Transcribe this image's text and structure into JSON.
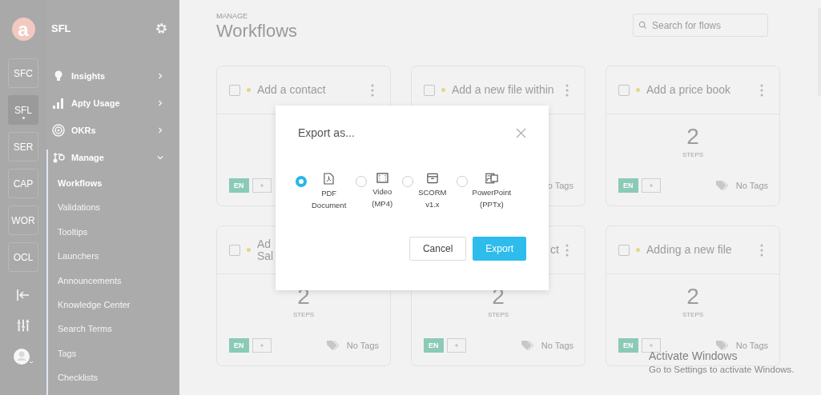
{
  "rail": {
    "logo": "a",
    "apps": [
      {
        "label": "SFC",
        "selected": false
      },
      {
        "label": "SFL",
        "selected": true
      },
      {
        "label": "SER",
        "selected": false
      },
      {
        "label": "CAP",
        "selected": false
      },
      {
        "label": "WOR",
        "selected": false
      },
      {
        "label": "OCL",
        "selected": false
      }
    ]
  },
  "nav": {
    "title": "SFL",
    "items": [
      {
        "label": "Insights",
        "kind": "bulb",
        "expanded": false
      },
      {
        "label": "Apty Usage",
        "kind": "bars",
        "expanded": false
      },
      {
        "label": "OKRs",
        "kind": "target",
        "expanded": false
      },
      {
        "label": "Manage",
        "kind": "flow",
        "expanded": true,
        "children": [
          {
            "label": "Workflows",
            "selected": true
          },
          {
            "label": "Validations",
            "selected": false
          },
          {
            "label": "Tooltips",
            "selected": false
          },
          {
            "label": "Launchers",
            "selected": false
          },
          {
            "label": "Announcements",
            "selected": false
          },
          {
            "label": "Knowledge Center",
            "selected": false
          },
          {
            "label": "Search Terms",
            "selected": false
          },
          {
            "label": "Tags",
            "selected": false
          },
          {
            "label": "Checklists",
            "selected": false
          }
        ]
      }
    ]
  },
  "main": {
    "section": "MANAGE",
    "title": "Workflows",
    "search": {
      "placeholder": "Search for flows"
    },
    "cards": [
      {
        "kind": "left",
        "title": "Add a contact",
        "checked": false,
        "menu": true,
        "lang": "EN"
      },
      {
        "kind": "left",
        "title": "Add a new file within",
        "checked": false,
        "menu": true,
        "tags": "o Tags"
      },
      {
        "kind": "left",
        "title": "Add a price book",
        "checked": false,
        "menu": true,
        "steps": "2",
        "steps_label": "STEPS",
        "lang": "EN",
        "tags": "No Tags"
      },
      {
        "kind": "left",
        "title": "Ad\nSal",
        "checked": false,
        "menu": false,
        "steps": "2",
        "steps_label": "STEPS",
        "lang": "EN",
        "tags": "No Tags"
      },
      {
        "kind": "right",
        "title": "ct",
        "menu": true,
        "steps": "2",
        "steps_label": "STEPS",
        "lang": "EN",
        "tags": "No Tags"
      },
      {
        "kind": "left",
        "title": "Adding a new file",
        "checked": false,
        "menu": true,
        "steps": "2",
        "steps_label": "STEPS",
        "lang": "EN",
        "tags": "No Tags"
      }
    ]
  },
  "dialog": {
    "title": "Export as...",
    "options": [
      {
        "label": "PDF Document",
        "kind": "pdf",
        "selected": true
      },
      {
        "label": "Video (MP4)",
        "kind": "video",
        "selected": false
      },
      {
        "label": "SCORM v1.x",
        "kind": "scorm",
        "selected": false
      },
      {
        "label": "PowerPoint (PPTx)",
        "kind": "ppt",
        "selected": false
      }
    ],
    "buttons": [
      {
        "label": "Cancel",
        "kind": "secondary"
      },
      {
        "label": "Export",
        "kind": "primary"
      }
    ]
  },
  "os_notice": {
    "title": "Activate Windows",
    "text": "Go to Settings to activate Windows."
  }
}
